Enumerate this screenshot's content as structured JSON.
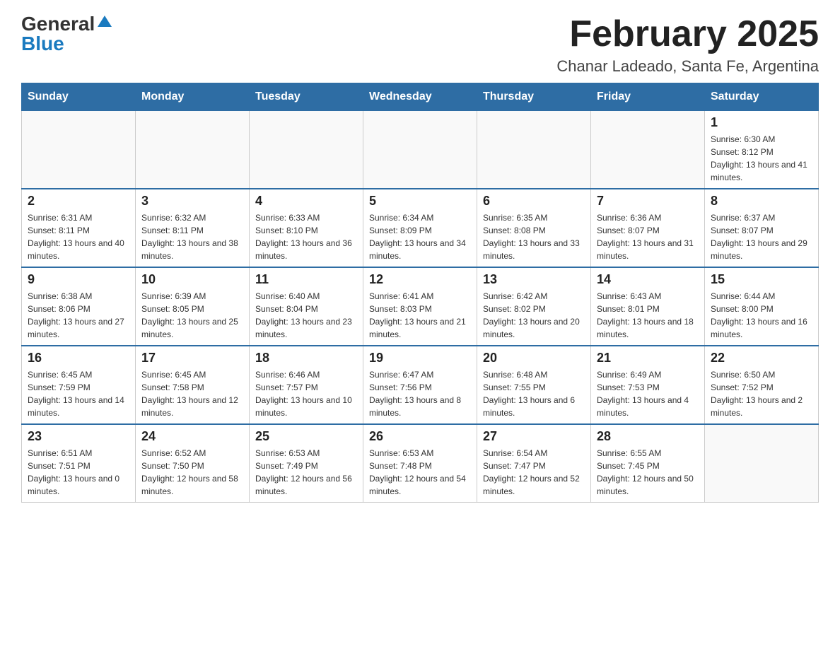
{
  "header": {
    "logo_general": "General",
    "logo_blue": "Blue",
    "month_title": "February 2025",
    "location": "Chanar Ladeado, Santa Fe, Argentina"
  },
  "weekdays": [
    "Sunday",
    "Monday",
    "Tuesday",
    "Wednesday",
    "Thursday",
    "Friday",
    "Saturday"
  ],
  "weeks": [
    [
      {
        "day": "",
        "sunrise": "",
        "sunset": "",
        "daylight": ""
      },
      {
        "day": "",
        "sunrise": "",
        "sunset": "",
        "daylight": ""
      },
      {
        "day": "",
        "sunrise": "",
        "sunset": "",
        "daylight": ""
      },
      {
        "day": "",
        "sunrise": "",
        "sunset": "",
        "daylight": ""
      },
      {
        "day": "",
        "sunrise": "",
        "sunset": "",
        "daylight": ""
      },
      {
        "day": "",
        "sunrise": "",
        "sunset": "",
        "daylight": ""
      },
      {
        "day": "1",
        "sunrise": "Sunrise: 6:30 AM",
        "sunset": "Sunset: 8:12 PM",
        "daylight": "Daylight: 13 hours and 41 minutes."
      }
    ],
    [
      {
        "day": "2",
        "sunrise": "Sunrise: 6:31 AM",
        "sunset": "Sunset: 8:11 PM",
        "daylight": "Daylight: 13 hours and 40 minutes."
      },
      {
        "day": "3",
        "sunrise": "Sunrise: 6:32 AM",
        "sunset": "Sunset: 8:11 PM",
        "daylight": "Daylight: 13 hours and 38 minutes."
      },
      {
        "day": "4",
        "sunrise": "Sunrise: 6:33 AM",
        "sunset": "Sunset: 8:10 PM",
        "daylight": "Daylight: 13 hours and 36 minutes."
      },
      {
        "day": "5",
        "sunrise": "Sunrise: 6:34 AM",
        "sunset": "Sunset: 8:09 PM",
        "daylight": "Daylight: 13 hours and 34 minutes."
      },
      {
        "day": "6",
        "sunrise": "Sunrise: 6:35 AM",
        "sunset": "Sunset: 8:08 PM",
        "daylight": "Daylight: 13 hours and 33 minutes."
      },
      {
        "day": "7",
        "sunrise": "Sunrise: 6:36 AM",
        "sunset": "Sunset: 8:07 PM",
        "daylight": "Daylight: 13 hours and 31 minutes."
      },
      {
        "day": "8",
        "sunrise": "Sunrise: 6:37 AM",
        "sunset": "Sunset: 8:07 PM",
        "daylight": "Daylight: 13 hours and 29 minutes."
      }
    ],
    [
      {
        "day": "9",
        "sunrise": "Sunrise: 6:38 AM",
        "sunset": "Sunset: 8:06 PM",
        "daylight": "Daylight: 13 hours and 27 minutes."
      },
      {
        "day": "10",
        "sunrise": "Sunrise: 6:39 AM",
        "sunset": "Sunset: 8:05 PM",
        "daylight": "Daylight: 13 hours and 25 minutes."
      },
      {
        "day": "11",
        "sunrise": "Sunrise: 6:40 AM",
        "sunset": "Sunset: 8:04 PM",
        "daylight": "Daylight: 13 hours and 23 minutes."
      },
      {
        "day": "12",
        "sunrise": "Sunrise: 6:41 AM",
        "sunset": "Sunset: 8:03 PM",
        "daylight": "Daylight: 13 hours and 21 minutes."
      },
      {
        "day": "13",
        "sunrise": "Sunrise: 6:42 AM",
        "sunset": "Sunset: 8:02 PM",
        "daylight": "Daylight: 13 hours and 20 minutes."
      },
      {
        "day": "14",
        "sunrise": "Sunrise: 6:43 AM",
        "sunset": "Sunset: 8:01 PM",
        "daylight": "Daylight: 13 hours and 18 minutes."
      },
      {
        "day": "15",
        "sunrise": "Sunrise: 6:44 AM",
        "sunset": "Sunset: 8:00 PM",
        "daylight": "Daylight: 13 hours and 16 minutes."
      }
    ],
    [
      {
        "day": "16",
        "sunrise": "Sunrise: 6:45 AM",
        "sunset": "Sunset: 7:59 PM",
        "daylight": "Daylight: 13 hours and 14 minutes."
      },
      {
        "day": "17",
        "sunrise": "Sunrise: 6:45 AM",
        "sunset": "Sunset: 7:58 PM",
        "daylight": "Daylight: 13 hours and 12 minutes."
      },
      {
        "day": "18",
        "sunrise": "Sunrise: 6:46 AM",
        "sunset": "Sunset: 7:57 PM",
        "daylight": "Daylight: 13 hours and 10 minutes."
      },
      {
        "day": "19",
        "sunrise": "Sunrise: 6:47 AM",
        "sunset": "Sunset: 7:56 PM",
        "daylight": "Daylight: 13 hours and 8 minutes."
      },
      {
        "day": "20",
        "sunrise": "Sunrise: 6:48 AM",
        "sunset": "Sunset: 7:55 PM",
        "daylight": "Daylight: 13 hours and 6 minutes."
      },
      {
        "day": "21",
        "sunrise": "Sunrise: 6:49 AM",
        "sunset": "Sunset: 7:53 PM",
        "daylight": "Daylight: 13 hours and 4 minutes."
      },
      {
        "day": "22",
        "sunrise": "Sunrise: 6:50 AM",
        "sunset": "Sunset: 7:52 PM",
        "daylight": "Daylight: 13 hours and 2 minutes."
      }
    ],
    [
      {
        "day": "23",
        "sunrise": "Sunrise: 6:51 AM",
        "sunset": "Sunset: 7:51 PM",
        "daylight": "Daylight: 13 hours and 0 minutes."
      },
      {
        "day": "24",
        "sunrise": "Sunrise: 6:52 AM",
        "sunset": "Sunset: 7:50 PM",
        "daylight": "Daylight: 12 hours and 58 minutes."
      },
      {
        "day": "25",
        "sunrise": "Sunrise: 6:53 AM",
        "sunset": "Sunset: 7:49 PM",
        "daylight": "Daylight: 12 hours and 56 minutes."
      },
      {
        "day": "26",
        "sunrise": "Sunrise: 6:53 AM",
        "sunset": "Sunset: 7:48 PM",
        "daylight": "Daylight: 12 hours and 54 minutes."
      },
      {
        "day": "27",
        "sunrise": "Sunrise: 6:54 AM",
        "sunset": "Sunset: 7:47 PM",
        "daylight": "Daylight: 12 hours and 52 minutes."
      },
      {
        "day": "28",
        "sunrise": "Sunrise: 6:55 AM",
        "sunset": "Sunset: 7:45 PM",
        "daylight": "Daylight: 12 hours and 50 minutes."
      },
      {
        "day": "",
        "sunrise": "",
        "sunset": "",
        "daylight": ""
      }
    ]
  ]
}
